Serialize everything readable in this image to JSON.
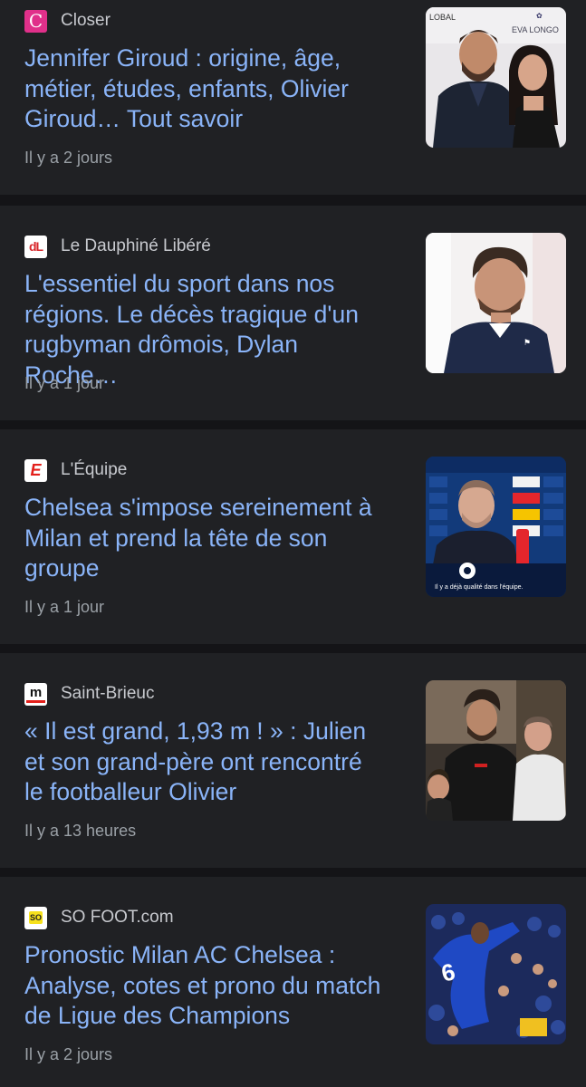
{
  "articles": [
    {
      "source": "Closer",
      "logo_icon": "closer-logo-icon",
      "logo_text": "C",
      "headline": "Jennifer Giroud : origine, âge, métier, études, enfants, Olivier Giroud… Tout savoir",
      "time": "Il y a 2 jours",
      "thumbnail": "couple-photo"
    },
    {
      "source": "Le Dauphiné Libéré",
      "logo_icon": "dauphine-logo-icon",
      "logo_text": "dL",
      "headline": "L'essentiel du sport dans nos régions. Le décès tragique d'un rugbyman drômois, Dylan Roche…",
      "time": "Il y a 1 jour",
      "thumbnail": "rugby-player-photo"
    },
    {
      "source": "L'Équipe",
      "logo_icon": "equipe-logo-icon",
      "logo_text": "E",
      "headline": "Chelsea s'impose sereinement à Milan et prend la tête de son groupe",
      "time": "Il y a 1 jour",
      "thumbnail": "press-conference-photo",
      "thumb_caption": "Il y a déjà qualité dans l'équipe."
    },
    {
      "source": "Saint-Brieuc",
      "logo_icon": "saint-brieuc-logo-icon",
      "logo_text": "m",
      "headline": "« Il est grand, 1,93 m ! » : Julien et son grand-père ont rencontré le footballeur Olivier",
      "time": "Il y a 13 heures",
      "thumbnail": "fans-photo"
    },
    {
      "source": "SO FOOT.com",
      "logo_icon": "sofoot-logo-icon",
      "logo_text": "SO",
      "headline": "Pronostic Milan AC Chelsea : Analyse, cotes et prono du match de Ligue des Champions",
      "time": "Il y a 2 jours",
      "thumbnail": "match-celebration-photo"
    }
  ],
  "colors": {
    "card_bg": "#202124",
    "divider": "#141417",
    "headline": "#8ab4f8",
    "source": "#c8cacf",
    "time": "#9aa0a6"
  }
}
